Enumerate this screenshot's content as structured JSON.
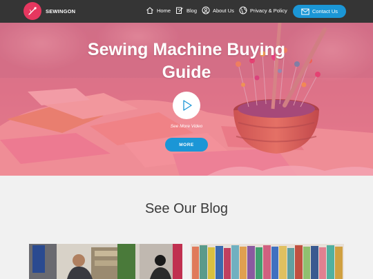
{
  "brand": {
    "name": "SEWINGON",
    "logo_color": "#e6375f"
  },
  "nav": {
    "items": [
      {
        "label": "Home",
        "icon": "home-icon"
      },
      {
        "label": "Blog",
        "icon": "edit-icon"
      },
      {
        "label": "About Us",
        "icon": "user-icon"
      },
      {
        "label": "Privacy & Policy",
        "icon": "globe-icon"
      }
    ],
    "contact_label": "Contact Us",
    "contact_icon": "mail-icon"
  },
  "hero": {
    "title_line1": "Sewing Machine Buying",
    "title_line2": "Guide",
    "video_label": "See More Video",
    "more_label": "MORE",
    "overlay_color": "#ec4678"
  },
  "blog": {
    "heading": "See Our Blog"
  },
  "colors": {
    "accent": "#1b96d6",
    "navbar": "#353535",
    "background": "#f1f1f1"
  }
}
